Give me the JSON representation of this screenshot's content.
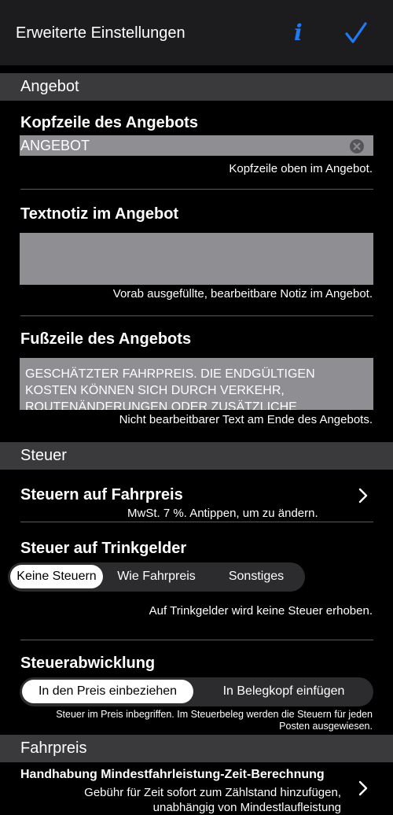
{
  "nav": {
    "title": "Erweiterte Einstellungen",
    "info_icon": "info-icon",
    "done_icon": "checkmark-icon",
    "info_glyph": "i",
    "accent": "#1f7af5"
  },
  "sections": {
    "angebot": "Angebot",
    "steuer": "Steuer",
    "fahrpreis": "Fahrpreis"
  },
  "header_field": {
    "label": "Kopfzeile des Angebots",
    "value": "ANGEBOT",
    "helper": "Kopfzeile oben im Angebot."
  },
  "note_field": {
    "label": "Textnotiz im Angebot",
    "value": "",
    "helper": "Vorab ausgefüllte, bearbeitbare Notiz im Angebot."
  },
  "footer_field": {
    "label": "Fußzeile des Angebots",
    "value": "GESCHÄTZTER FAHRPREIS. DIE ENDGÜLTIGEN KOSTEN KÖNNEN SICH DURCH VERKEHR, ROUTENÄNDERUNGEN ODER ZUSÄTZLICHE",
    "helper": "Nicht bearbeitbarer Text am Ende des Angebots."
  },
  "fare_tax": {
    "label": "Steuern auf Fahrpreis",
    "detail": "MwSt. 7 %. Antippen, um zu ändern."
  },
  "tip_tax": {
    "label": "Steuer auf Trinkgelder",
    "options": [
      "Keine Steuern",
      "Wie Fahrpreis",
      "Sonstiges"
    ],
    "selected": "Keine Steuern",
    "helper": "Auf Trinkgelder wird keine Steuer erhoben."
  },
  "tax_handling": {
    "label": "Steuerabwicklung",
    "options": [
      "In den Preis einbeziehen",
      "In Belegkopf einfügen"
    ],
    "selected": "In den Preis einbeziehen",
    "helper_line1": "Steuer im Preis inbegriffen. Im Steuerbeleg werden die Steuern für jeden",
    "helper_line2": "Posten ausgewiesen."
  },
  "min_fare": {
    "label": "Handhabung Mindestfahrleistung-Zeit-Berechnung",
    "detail_line1": "Gebühr für Zeit sofort zum Zählstand hinzufügen,",
    "detail_line2": "unabhängig von Mindestlaufleistung"
  }
}
